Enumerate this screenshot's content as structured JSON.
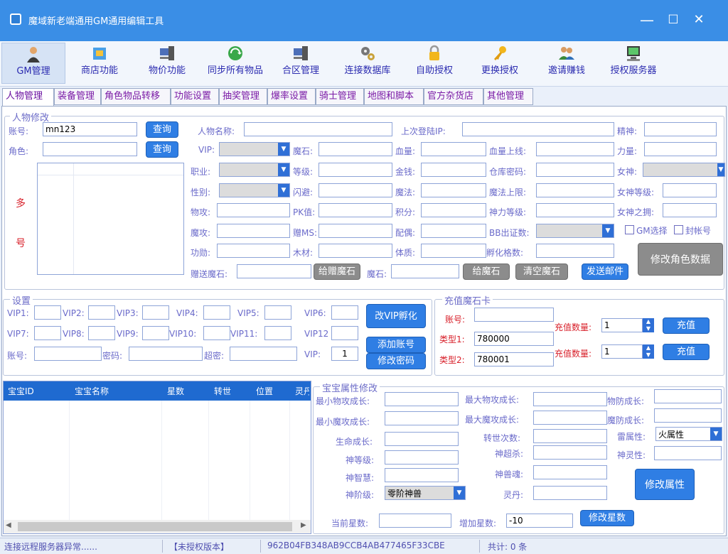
{
  "window": {
    "title": "魔域新老端通用GM通用编辑工具",
    "minimize": "—",
    "maximize": "☐",
    "close": "✕"
  },
  "toolbar": [
    {
      "label": "GM管理",
      "icon": "person-icon"
    },
    {
      "label": "商店功能",
      "icon": "shop-icon"
    },
    {
      "label": "物价功能",
      "icon": "computer-icon"
    },
    {
      "label": "同步所有物品",
      "icon": "sync-icon"
    },
    {
      "label": "合区管理",
      "icon": "computer-icon"
    },
    {
      "label": "连接数据库",
      "icon": "gears-icon"
    },
    {
      "label": "自助授权",
      "icon": "lock-icon"
    },
    {
      "label": "更换授权",
      "icon": "key-icon"
    },
    {
      "label": "邀请赚钱",
      "icon": "users-icon"
    },
    {
      "label": "授权服务器",
      "icon": "server-icon"
    }
  ],
  "tabs": [
    "人物管理",
    "装备管理",
    "角色物品转移",
    "功能设置",
    "抽奖管理",
    "爆率设置",
    "骑士管理",
    "地图和脚本",
    "官方杂货店",
    "其他管理"
  ],
  "char": {
    "group": "人物修改",
    "account_label": "账号:",
    "account_value": "mn123",
    "role_label": "角色:",
    "query": "查询",
    "multi1": "多",
    "multi2": "号",
    "name_label": "人物名称:",
    "lastip_label": "上次登陆IP:",
    "spirit_label": "精神:",
    "vip_label": "VIP:",
    "magicstone_label": "魔石:",
    "hp_label": "血量:",
    "hpmax_label": "血量上线:",
    "power_label": "力量:",
    "job_label": "职业:",
    "level_label": "等级:",
    "money_label": "金钱:",
    "wh_label": "仓库密码:",
    "goddess_label": "女神:",
    "sex_label": "性别:",
    "dodge_label": "闪避:",
    "magic_label": "魔法:",
    "magicmax_label": "魔法上限:",
    "glevel_label": "女神等级:",
    "patk_label": "物攻:",
    "pk_label": "PK值:",
    "score_label": "积分:",
    "divine_label": "神力等级:",
    "ghug_label": "女神之拥:",
    "matk_label": "魔攻:",
    "ms_label": "赠MS:",
    "spouse_label": "配偶:",
    "bb_label": "BB出证数:",
    "gm_check": "GM选择",
    "ban_check": "封帐号",
    "merit_label": "功勋:",
    "wood_label": "木材:",
    "phys_label": "体质:",
    "hatch_label": "孵化格数:",
    "gift_label": "赠送魔石:",
    "gift_btn": "给赠魔石",
    "stone_label": "魔石:",
    "give_btn": "给魔石",
    "clear_btn": "清空魔石",
    "mail_btn": "发送邮件",
    "modify_btn": "修改角色数据"
  },
  "settings": {
    "group": "设置",
    "vips": [
      "VIP1:",
      "VIP2:",
      "VIP3:",
      "VIP4:",
      "VIP5:",
      "VIP6:",
      "VIP7:",
      "VIP8:",
      "VIP9:",
      "VIP10:",
      "VIP11:",
      "VIP12"
    ],
    "account_label": "账号:",
    "pwd_label": "密码:",
    "super_label": "超密:",
    "vip_label": "VIP:",
    "vip_value": "1",
    "change_vip": "改VIP孵化",
    "add_account": "添加账号",
    "change_pwd": "修改密码"
  },
  "recharge": {
    "group": "充值魔石卡",
    "account_label": "账号:",
    "type1_label": "类型1:",
    "type1_value": "780000",
    "type2_label": "类型2:",
    "type2_value": "780001",
    "qty_label": "充值数量:",
    "qty1": "1",
    "qty2": "1",
    "btn": "充值"
  },
  "pets": {
    "columns": [
      "宝宝ID",
      "宝宝名称",
      "星数",
      "转世",
      "位置",
      "灵丹"
    ]
  },
  "pet_attr": {
    "group": "宝宝属性修改",
    "min_patk": "最小物攻成长:",
    "max_patk": "最大物攻成长:",
    "pdef": "物防成长:",
    "min_matk": "最小魔攻成长:",
    "max_matk": "最大魔攻成长:",
    "mdef": "魔防成长:",
    "life": "生命成长:",
    "reborn": "转世次数:",
    "thunder": "雷属性:",
    "thunder_value": "火属性",
    "god_level": "神等级:",
    "god_kill": "神超杀:",
    "god_spirit": "神灵性:",
    "god_wisdom": "神智慧:",
    "god_soul": "神兽魂:",
    "god_rank": "神阶级:",
    "god_rank_value": "零阶神兽",
    "pill": "灵丹:",
    "modify_btn": "修改属性",
    "cur_star": "当前星数:",
    "add_star": "增加星数:",
    "add_star_value": "-10",
    "star_btn": "修改星数"
  },
  "status": {
    "conn": "连接远程服务器异常......",
    "version": "【未授权版本】",
    "machine": "962B04FB348AB9CCB4AB477465F33CBE",
    "total": "共计: 0 条"
  },
  "colors": {
    "titlebar": "#3a8ee6",
    "button": "#2f7ee4",
    "label": "#6a6aca",
    "red": "#d8202a"
  }
}
